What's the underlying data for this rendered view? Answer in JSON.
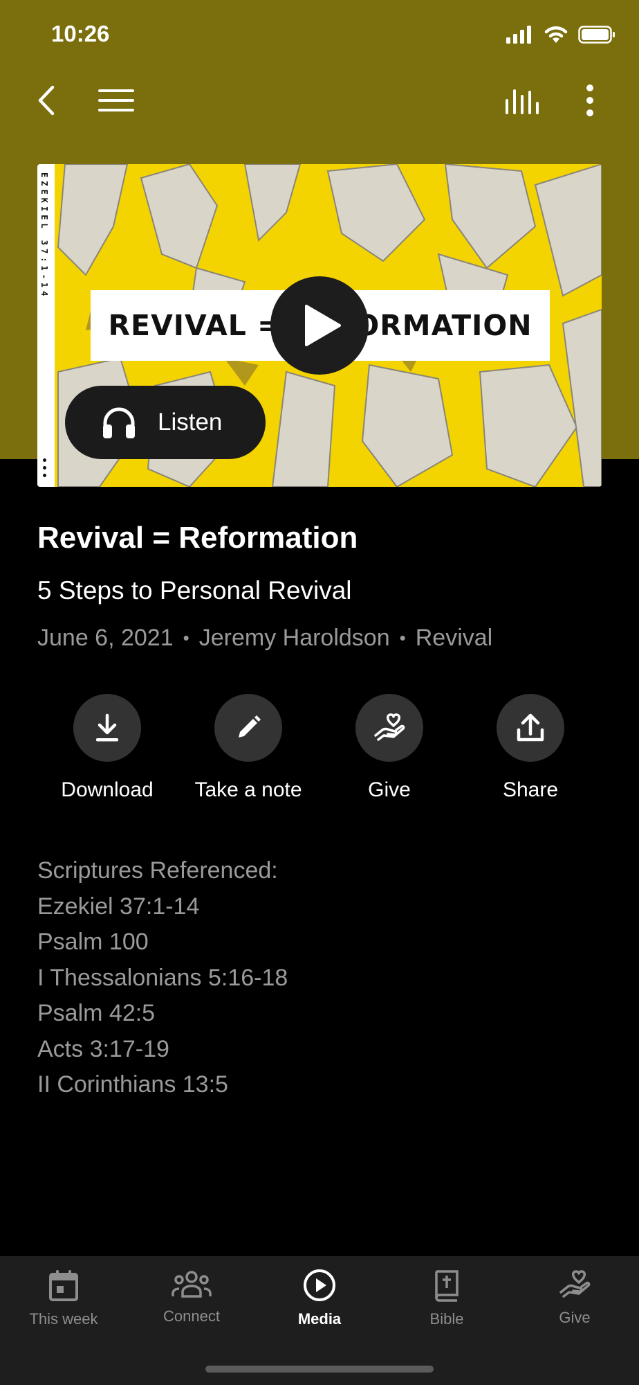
{
  "status_bar": {
    "time": "10:26"
  },
  "artwork": {
    "title": "REVIVAL = REFORMATION",
    "spine_text": "EZEKIEL 37:1-14",
    "listen_label": "Listen"
  },
  "message": {
    "title": "Revival = Reformation",
    "subtitle": "5 Steps to Personal Revival",
    "date": "June 6, 2021",
    "speaker": "Jeremy Haroldson",
    "series": "Revival",
    "separator": "•"
  },
  "actions": [
    {
      "label": "Download",
      "icon": "download-icon"
    },
    {
      "label": "Take a note",
      "icon": "pencil-icon"
    },
    {
      "label": "Give",
      "icon": "give-hand-heart-icon"
    },
    {
      "label": "Share",
      "icon": "share-icon"
    }
  ],
  "scriptures": {
    "heading": "Scriptures Referenced:",
    "items": [
      "Ezekiel 37:1-14",
      "Psalm 100",
      "I Thessalonians 5:16-18",
      "Psalm 42:5",
      "Acts 3:17-19",
      "II Corinthians 13:5"
    ]
  },
  "tabs": [
    {
      "label": "This week",
      "icon": "calendar-icon",
      "active": false
    },
    {
      "label": "Connect",
      "icon": "people-icon",
      "active": false
    },
    {
      "label": "Media",
      "icon": "play-circle-icon",
      "active": true
    },
    {
      "label": "Bible",
      "icon": "bible-icon",
      "active": false
    },
    {
      "label": "Give",
      "icon": "give-hand-heart-icon",
      "active": false
    }
  ],
  "colors": {
    "header_bg": "#7b6e0c",
    "artwork_yellow": "#f4d400",
    "page_bg": "#000000",
    "tabbar_bg": "#1e1e1e",
    "muted_text": "#9a9a9a"
  }
}
